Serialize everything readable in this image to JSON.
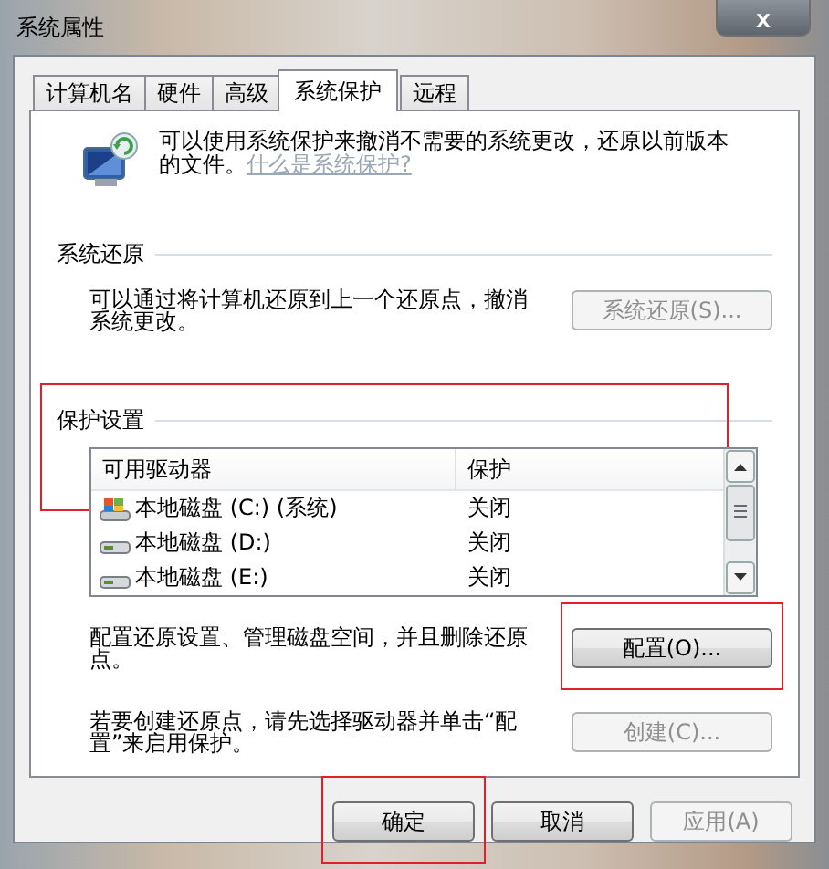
{
  "window": {
    "title": "系统属性",
    "close": "x"
  },
  "tabs": [
    {
      "label": "计算机名",
      "selected": false
    },
    {
      "label": "硬件",
      "selected": false
    },
    {
      "label": "高级",
      "selected": false
    },
    {
      "label": "系统保护",
      "selected": true
    },
    {
      "label": "远程",
      "selected": false
    }
  ],
  "intro": {
    "text": "可以使用系统保护来撤消不需要的系统更改，还原以前版本的文件。",
    "link": "什么是系统保护?"
  },
  "system_restore": {
    "heading": "系统还原",
    "text": "可以通过将计算机还原到上一个还原点，撤消系统更改。",
    "button": {
      "label": "系统还原(S)...",
      "disabled": true
    }
  },
  "protection": {
    "heading": "保护设置",
    "highlighted": true,
    "columns": [
      "可用驱动器",
      "保护"
    ],
    "rows": [
      {
        "drive": "本地磁盘 (C:) (系统)",
        "protection": "关闭",
        "kind": "system"
      },
      {
        "drive": "本地磁盘 (D:)",
        "protection": "关闭",
        "kind": "local"
      },
      {
        "drive": "本地磁盘 (E:)",
        "protection": "关闭",
        "kind": "local"
      }
    ],
    "configure": {
      "text": "配置还原设置、管理磁盘空间，并且删除还原点。",
      "button": {
        "label": "配置(O)...",
        "disabled": false,
        "highlighted": true
      }
    },
    "create": {
      "text": "若要创建还原点，请先选择驱动器并单击“配置”来启用保护。",
      "button": {
        "label": "创建(C)...",
        "disabled": true
      }
    }
  },
  "buttons": [
    {
      "label": "确定",
      "disabled": false,
      "highlighted": true
    },
    {
      "label": "取消",
      "disabled": false,
      "highlighted": false
    },
    {
      "label": "应用(A)",
      "disabled": true,
      "highlighted": false
    }
  ]
}
